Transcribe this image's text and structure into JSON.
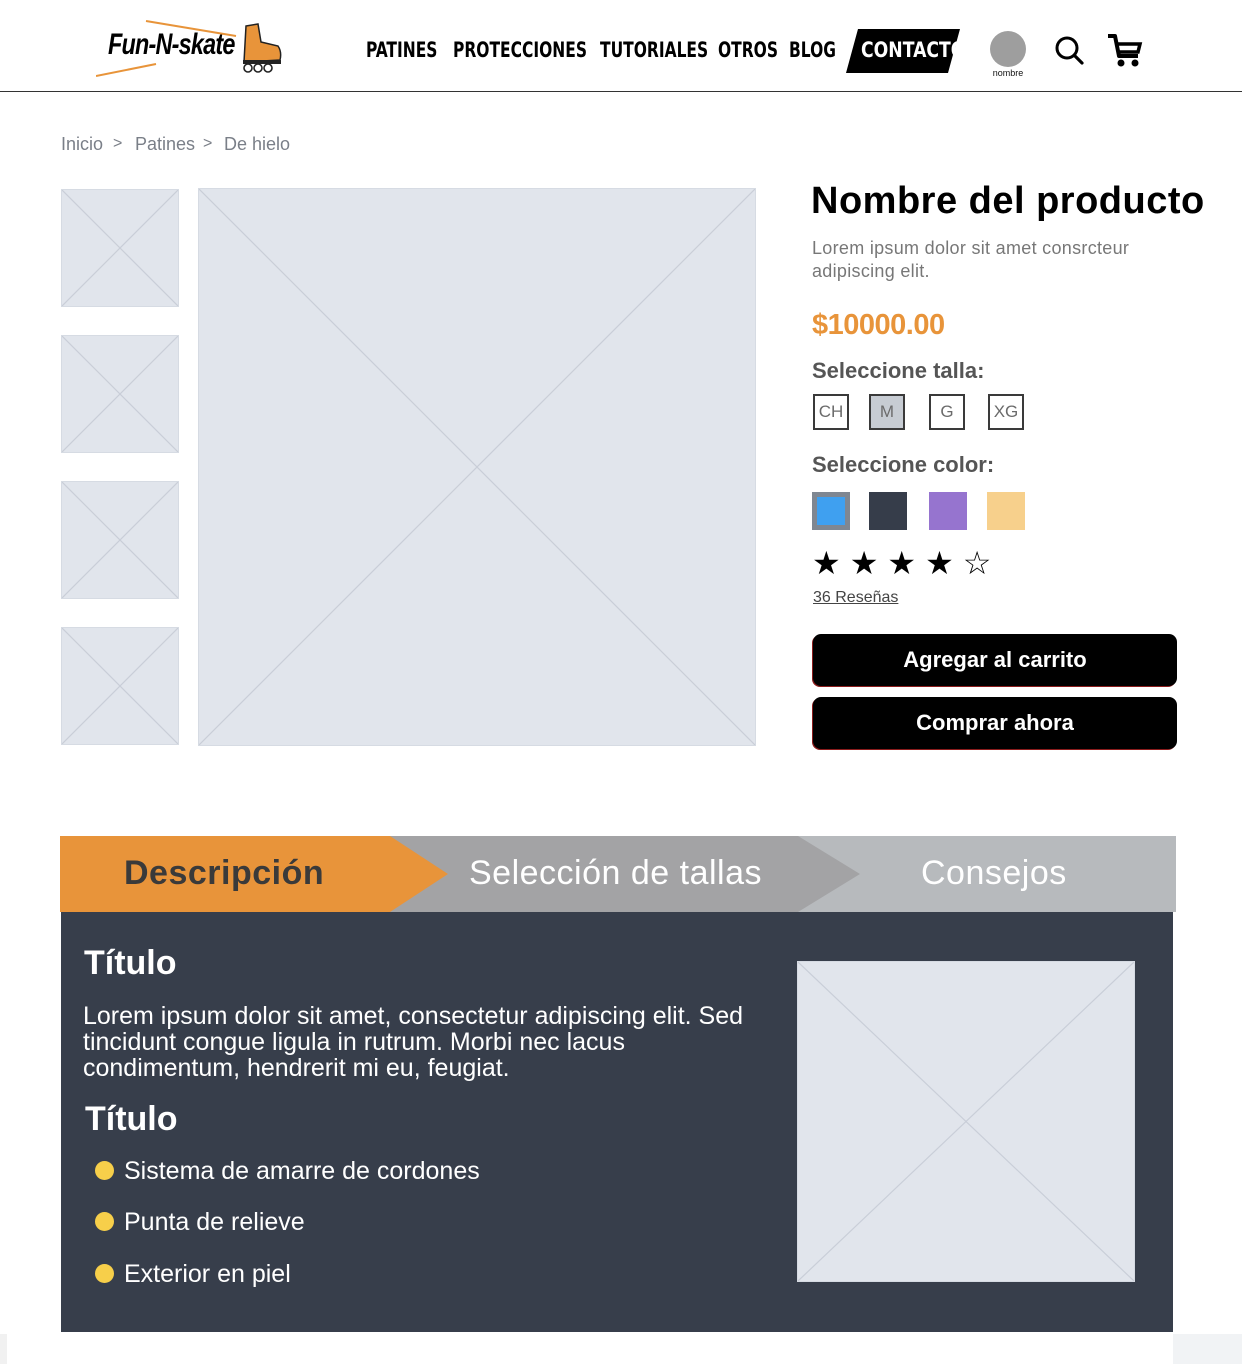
{
  "brand": {
    "name": "Fun-N-skate",
    "colors": {
      "accent": "#e8943a",
      "dark": "#373e4b",
      "placeholder": "#e1e5ec"
    }
  },
  "nav": {
    "items": [
      "PATINES",
      "PROTECCIONES",
      "TUTORIALES",
      "OTROS",
      "BLOG"
    ],
    "contact": "CONTACTO",
    "user_label": "nombre",
    "icons": [
      "search-icon",
      "cart-icon"
    ]
  },
  "breadcrumb": [
    "Inicio",
    "Patines",
    "De hielo"
  ],
  "product": {
    "title": "Nombre del producto",
    "description": "Lorem ipsum dolor sit amet consrcteur adipiscing elit.",
    "price": "$10000.00",
    "size_label": "Seleccione talla:",
    "sizes": [
      "CH",
      "M",
      "G",
      "XG"
    ],
    "selected_size": "M",
    "color_label": "Seleccione color:",
    "colors": [
      "#3fa0f0",
      "#363d4a",
      "#9674cf",
      "#f7d08c"
    ],
    "selected_color": "#3fa0f0",
    "rating": 4,
    "rating_max": 5,
    "reviews": "36 Reseñas",
    "add_to_cart": "Agregar al carrito",
    "buy_now": "Comprar ahora"
  },
  "tabs": {
    "items": [
      "Descripción",
      "Selección de tallas",
      "Consejos"
    ],
    "active": "Descripción",
    "colors": [
      "#e8943a",
      "#a3a3a5",
      "#b7babd"
    ]
  },
  "description": {
    "title1": "Título",
    "body": "Lorem ipsum dolor sit amet, consectetur adipiscing elit. Sed tincidunt congue ligula in rutrum. Morbi nec lacus condimentum, hendrerit mi eu, feugiat.",
    "title2": "Título",
    "features": [
      "Sistema de amarre de cordones",
      "Punta de relieve",
      "Exterior en piel"
    ]
  }
}
